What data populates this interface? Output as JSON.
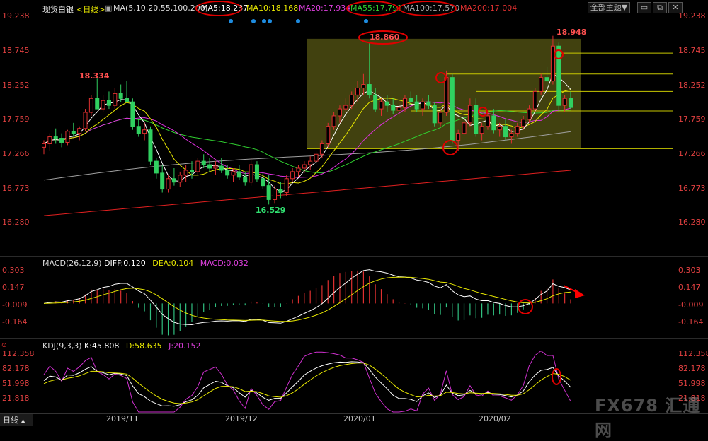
{
  "header": {
    "title": "现货白银",
    "period": "<日线>",
    "ma_params": "MA(5,10,20,55,100,200)",
    "ma5": "MA5:18.237",
    "ma10": "MA10:18.168",
    "ma20": "MA20:17.934",
    "ma55": "MA55:17.791",
    "ma100": "MA100:17.570",
    "ma200": "MA200:17.004",
    "theme_button": "全部主题",
    "colors": {
      "ma5": "#ffffff",
      "ma10": "#e8e800",
      "ma20": "#e030e0",
      "ma55": "#30d030",
      "ma100": "#a0a0a0",
      "ma200": "#e02020",
      "up": "#e03030",
      "down": "#30d060"
    }
  },
  "price_axis": {
    "ticks": [
      "19.238",
      "18.745",
      "18.252",
      "17.759",
      "17.266",
      "16.773",
      "16.280"
    ]
  },
  "annotations": {
    "high_left": "18.334",
    "low": "16.529",
    "high_box": "18.860",
    "high_right": "18.948"
  },
  "macd": {
    "title": "MACD(26,12,9)",
    "diff": "DIFF:0.120",
    "dea": "DEA:0.104",
    "macd": "MACD:0.032",
    "ticks": [
      "0.303",
      "0.147",
      "-0.009",
      "-0.164"
    ]
  },
  "kdj": {
    "title": "KDJ(9,3,3)",
    "k": "K:45.808",
    "d": "D:58.635",
    "j": "J:20.152",
    "ticks": [
      "112.358",
      "82.178",
      "51.998",
      "21.818"
    ]
  },
  "time_axis": {
    "labels": [
      "2019/11",
      "2019/12",
      "2020/01",
      "2020/02"
    ]
  },
  "bottom_tab": "日线",
  "watermark": "FX678 汇通网",
  "chart_data": {
    "type": "candlestick",
    "title": "现货白银<日线>",
    "y_ticks": [
      19.238,
      18.745,
      18.252,
      17.759,
      17.266,
      16.773,
      16.28
    ],
    "ylim": [
      16.1,
      19.33
    ],
    "x_labels": [
      "2019/11",
      "2019/12",
      "2020/01",
      "2020/02"
    ],
    "ohlc": [
      [
        17.35,
        17.45,
        17.25,
        17.4
      ],
      [
        17.4,
        17.55,
        17.3,
        17.5
      ],
      [
        17.5,
        17.62,
        17.4,
        17.48
      ],
      [
        17.48,
        17.55,
        17.35,
        17.42
      ],
      [
        17.42,
        17.6,
        17.38,
        17.58
      ],
      [
        17.58,
        17.7,
        17.5,
        17.55
      ],
      [
        17.55,
        17.65,
        17.45,
        17.62
      ],
      [
        17.62,
        17.9,
        17.58,
        17.85
      ],
      [
        17.85,
        18.1,
        17.8,
        18.05
      ],
      [
        18.05,
        18.334,
        17.95,
        17.9
      ],
      [
        17.9,
        18.1,
        17.85,
        18.02
      ],
      [
        18.02,
        18.15,
        17.9,
        17.95
      ],
      [
        17.95,
        18.2,
        17.9,
        18.12
      ],
      [
        18.12,
        18.25,
        18.0,
        18.05
      ],
      [
        18.05,
        18.3,
        18.0,
        18.0
      ],
      [
        18.0,
        18.05,
        17.6,
        17.65
      ],
      [
        17.65,
        17.75,
        17.5,
        17.55
      ],
      [
        17.55,
        17.7,
        17.45,
        17.6
      ],
      [
        17.6,
        17.65,
        17.1,
        17.15
      ],
      [
        17.15,
        17.2,
        16.9,
        16.98
      ],
      [
        16.98,
        17.1,
        16.7,
        16.75
      ],
      [
        16.75,
        16.95,
        16.7,
        16.9
      ],
      [
        16.9,
        17.05,
        16.8,
        16.85
      ],
      [
        16.85,
        17.0,
        16.78,
        16.95
      ],
      [
        16.95,
        17.1,
        16.85,
        17.02
      ],
      [
        17.02,
        17.15,
        16.9,
        17.0
      ],
      [
        17.0,
        17.2,
        16.95,
        17.15
      ],
      [
        17.15,
        17.25,
        17.05,
        17.1
      ],
      [
        17.1,
        17.2,
        17.0,
        17.05
      ],
      [
        17.05,
        17.15,
        16.95,
        17.08
      ],
      [
        17.08,
        17.2,
        16.98,
        17.02
      ],
      [
        17.02,
        17.1,
        16.9,
        16.95
      ],
      [
        16.95,
        17.05,
        16.85,
        17.0
      ],
      [
        17.0,
        17.1,
        16.88,
        16.92
      ],
      [
        16.92,
        17.0,
        16.8,
        16.85
      ],
      [
        16.85,
        17.2,
        16.8,
        17.1
      ],
      [
        17.1,
        17.15,
        16.85,
        16.9
      ],
      [
        16.9,
        17.0,
        16.75,
        16.8
      ],
      [
        16.8,
        16.95,
        16.529,
        16.6
      ],
      [
        16.6,
        16.8,
        16.55,
        16.75
      ],
      [
        16.75,
        16.85,
        16.62,
        16.7
      ],
      [
        16.7,
        16.95,
        16.65,
        16.9
      ],
      [
        16.9,
        17.05,
        16.85,
        17.0
      ],
      [
        17.0,
        17.1,
        16.92,
        17.05
      ],
      [
        17.05,
        17.15,
        16.98,
        17.1
      ],
      [
        17.1,
        17.22,
        17.02,
        17.15
      ],
      [
        17.15,
        17.3,
        17.1,
        17.25
      ],
      [
        17.25,
        17.45,
        17.2,
        17.4
      ],
      [
        17.4,
        17.7,
        17.35,
        17.65
      ],
      [
        17.65,
        17.85,
        17.6,
        17.8
      ],
      [
        17.8,
        17.95,
        17.7,
        17.9
      ],
      [
        17.9,
        18.05,
        17.85,
        17.95
      ],
      [
        17.95,
        18.15,
        17.9,
        18.1
      ],
      [
        18.1,
        18.3,
        18.0,
        18.2
      ],
      [
        18.2,
        18.4,
        18.1,
        18.25
      ],
      [
        18.25,
        18.86,
        18.05,
        18.1
      ],
      [
        18.1,
        18.2,
        17.85,
        17.9
      ],
      [
        17.9,
        18.05,
        17.8,
        18.0
      ],
      [
        18.0,
        18.1,
        17.85,
        17.95
      ],
      [
        17.95,
        18.05,
        17.82,
        17.88
      ],
      [
        17.88,
        18.0,
        17.78,
        17.92
      ],
      [
        17.92,
        18.1,
        17.85,
        18.05
      ],
      [
        18.05,
        18.15,
        17.95,
        18.0
      ],
      [
        18.0,
        18.1,
        17.85,
        17.9
      ],
      [
        17.9,
        18.05,
        17.8,
        18.0
      ],
      [
        18.0,
        18.1,
        17.9,
        17.95
      ],
      [
        17.95,
        18.0,
        17.65,
        17.7
      ],
      [
        17.7,
        17.9,
        17.65,
        17.85
      ],
      [
        17.85,
        18.45,
        17.8,
        18.35
      ],
      [
        18.35,
        18.4,
        17.4,
        17.45
      ],
      [
        17.45,
        17.6,
        17.3,
        17.55
      ],
      [
        17.55,
        17.75,
        17.5,
        17.7
      ],
      [
        17.7,
        18.05,
        17.65,
        17.95
      ],
      [
        17.95,
        18.05,
        17.5,
        17.55
      ],
      [
        17.55,
        17.7,
        17.45,
        17.65
      ],
      [
        17.65,
        17.85,
        17.6,
        17.8
      ],
      [
        17.8,
        17.9,
        17.55,
        17.6
      ],
      [
        17.6,
        17.7,
        17.5,
        17.65
      ],
      [
        17.65,
        17.75,
        17.45,
        17.5
      ],
      [
        17.5,
        17.6,
        17.4,
        17.55
      ],
      [
        17.55,
        17.7,
        17.5,
        17.65
      ],
      [
        17.65,
        17.8,
        17.6,
        17.75
      ],
      [
        17.75,
        17.95,
        17.7,
        17.9
      ],
      [
        17.9,
        18.2,
        17.85,
        18.15
      ],
      [
        18.15,
        18.4,
        18.1,
        18.35
      ],
      [
        18.35,
        18.5,
        18.2,
        18.3
      ],
      [
        18.3,
        18.948,
        18.25,
        18.8
      ],
      [
        18.8,
        18.85,
        17.85,
        17.95
      ],
      [
        17.95,
        18.1,
        17.85,
        18.05
      ],
      [
        18.05,
        18.15,
        17.9,
        17.92
      ]
    ],
    "macd_series": {
      "ylim": [
        -0.26,
        0.36
      ],
      "ticks": [
        0.303,
        0.147,
        -0.009,
        -0.164
      ]
    },
    "kdj_series": {
      "ylim": [
        0,
        130
      ],
      "ticks": [
        112.358,
        82.178,
        51.998,
        21.818
      ]
    }
  }
}
